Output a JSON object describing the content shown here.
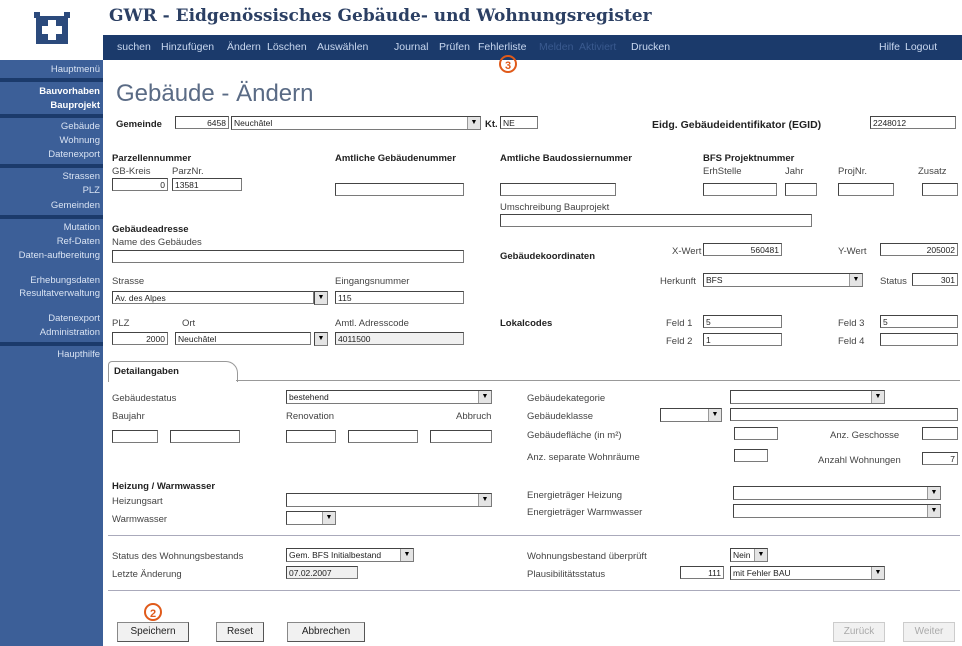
{
  "app": {
    "title": "GWR - Eidgenössisches Gebäude- und Wohnungsregister",
    "menu": [
      "suchen",
      "Hinzufügen",
      "Ändern",
      "Löschen",
      "Auswählen",
      "Journal",
      "Prüfen",
      "Fehlerliste",
      "Melden",
      "Aktiviert",
      "Drucken",
      "Hilfe",
      "Logout"
    ]
  },
  "sidebar": {
    "items": [
      "Hauptmenü",
      "Bauvorhaben",
      "Bauprojekt",
      "Gebäude",
      "Wohnung",
      "Datenexport",
      "Strassen",
      "PLZ",
      "Gemeinden",
      "Mutation",
      "Ref-Daten",
      "Daten-aufbereitung",
      "Erhebungsdaten",
      "Resultatverwaltung",
      "Datenexport",
      "Administration",
      "Haupthilfe"
    ]
  },
  "page": {
    "title": "Gebäude - Ändern",
    "annotation_top": "3",
    "annotation_bottom": "2"
  },
  "form": {
    "gemeinde_label": "Gemeinde",
    "gemeinde_nr": "6458",
    "gemeinde_name": "Neuchâtel",
    "kt_label": "Kt.",
    "kt_value": "NE",
    "egid_label": "Eidg. Gebäudeidentifikator (EGID)",
    "egid_value": "2248012",
    "parzelle_label": "Parzellennummer",
    "gb_kreis_label": "GB-Kreis",
    "parz_nr_label": "ParzNr.",
    "gb_kreis_value": "0",
    "parz_nr_value": "13581",
    "amtl_geb_label": "Amtliche Gebäudenummer",
    "amtl_baudossier_label": "Amtliche Baudossiernummer",
    "bfs_proj_label": "BFS Projektnummer",
    "erhstelle_label": "ErhStelle",
    "jahr_label": "Jahr",
    "projnr_label": "ProjNr.",
    "zusatz_label": "Zusatz",
    "umschreibung_label": "Umschreibung Bauprojekt",
    "gebadr_label": "Gebäudeadresse",
    "name_geb_label": "Name des Gebäudes",
    "strasse_label": "Strasse",
    "strasse_value": "Av. des Alpes",
    "eingang_label": "Eingangsnummer",
    "eingang_value": "115",
    "plz_label": "PLZ",
    "ort_label": "Ort",
    "plz_value": "2000",
    "ort_value": "Neuchâtel",
    "adresscode_label": "Amtl. Adresscode",
    "adresscode_value": "4011500",
    "gebkoord_label": "Gebäudekoordinaten",
    "xwert_label": "X-Wert",
    "xwert_value": "560481",
    "ywert_label": "Y-Wert",
    "ywert_value": "205002",
    "herkunft_label": "Herkunft",
    "herkunft_value": "BFS",
    "status_label": "Status",
    "status_value": "301",
    "lokalcodes_label": "Lokalcodes",
    "feld1_label": "Feld 1",
    "feld1_value": "5",
    "feld2_label": "Feld 2",
    "feld2_value": "1",
    "feld3_label": "Feld 3",
    "feld3_value": "5",
    "feld4_label": "Feld 4"
  },
  "tab": {
    "label": "Detailangaben"
  },
  "details": {
    "gebstatus_label": "Gebäudestatus",
    "gebstatus_value": "bestehend",
    "baujahr_label": "Baujahr",
    "renovation_label": "Renovation",
    "abbruch_label": "Abbruch",
    "gebkategorie_label": "Gebäudekategorie",
    "gebklasse_label": "Gebäudeklasse",
    "gebflaeche_label": "Gebäudefläche (in m²)",
    "anz_geschosse_label": "Anz. Geschosse",
    "separate_wohnr_label": "Anz. separate Wohnräume",
    "anz_wohnungen_label": "Anzahl Wohnungen",
    "anz_wohnungen_value": "7",
    "heizung_title": "Heizung / Warmwasser",
    "heizungsart_label": "Heizungsart",
    "warmwasser_label": "Warmwasser",
    "energie_heizung_label": "Energieträger Heizung",
    "energie_ww_label": "Energieträger Warmwasser",
    "wohnbestand_label": "Status des Wohnungsbestands",
    "wohnbestand_value": "Gem. BFS Initialbestand",
    "letzte_aenderung_label": "Letzte Änderung",
    "letzte_aenderung_value": "07.02.2007",
    "wohnbestand_ueberprueft_label": "Wohnungsbestand überprüft",
    "ueberprueft_value": "Nein",
    "plausi_label": "Plausibilitätsstatus",
    "plausi_code": "111",
    "plausi_value": "mit Fehler BAU"
  },
  "buttons": {
    "save": "Speichern",
    "reset": "Reset",
    "cancel": "Abbrechen",
    "back": "Zurück",
    "next": "Weiter"
  },
  "colors": {
    "menubar": "#1b3a6b",
    "sidebar": "#3c5f98",
    "annotation": "#e05a1a"
  }
}
